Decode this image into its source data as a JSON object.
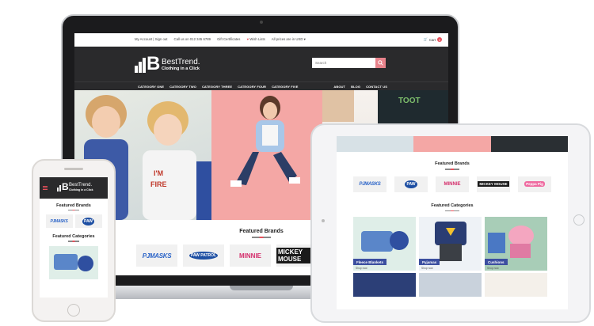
{
  "laptop": {
    "topbar": {
      "links": [
        "My Account | Sign out",
        "Call us on 012 345 6789",
        "Gift Certificates",
        "Wish Lists",
        "All prices are in USD"
      ],
      "cart_label": "Cart",
      "cart_count": "0"
    },
    "brand": {
      "name": "BestTrend.",
      "tagline": "Clothing in a Click",
      "mark": "B"
    },
    "search": {
      "placeholder": "Search"
    },
    "nav": {
      "categories": [
        "CATEGORY ONE",
        "CATEGORY TWO",
        "CATEGORY THREE",
        "CATEGORY FOUR",
        "CATEGORY FIVE"
      ],
      "right": [
        "ABOUT",
        "BLOG",
        "CONTACT US"
      ]
    },
    "featured_brands_title": "Featured Brands",
    "brands": [
      "PJMASKS",
      "PAW PATROL",
      "MINNIE",
      "MICKEY MOUSE"
    ]
  },
  "tablet": {
    "featured_brands_title": "Featured Brands",
    "brands": [
      "PJMASKS",
      "PAW",
      "MINNIE",
      "MICKEY MOUSE",
      "Peppa Pig"
    ],
    "featured_categories_title": "Featured Categories",
    "categories": [
      {
        "label": "Fleece Blankets",
        "link": "Shop now"
      },
      {
        "label": "Pyjamas",
        "link": "Shop now"
      },
      {
        "label": "Cushions",
        "link": "Shop now"
      }
    ]
  },
  "phone": {
    "brand": {
      "name": "BestTrend.",
      "tagline": "Clothing in a Click",
      "mark": "B"
    },
    "featured_brands_title": "Featured Brands",
    "brands": [
      "PJMASKS",
      "PAW"
    ],
    "featured_categories_title": "Featured Categories"
  },
  "colors": {
    "header": "#2a2a2c",
    "accent": "#e8505b",
    "category_label": "#3c4fa0"
  }
}
